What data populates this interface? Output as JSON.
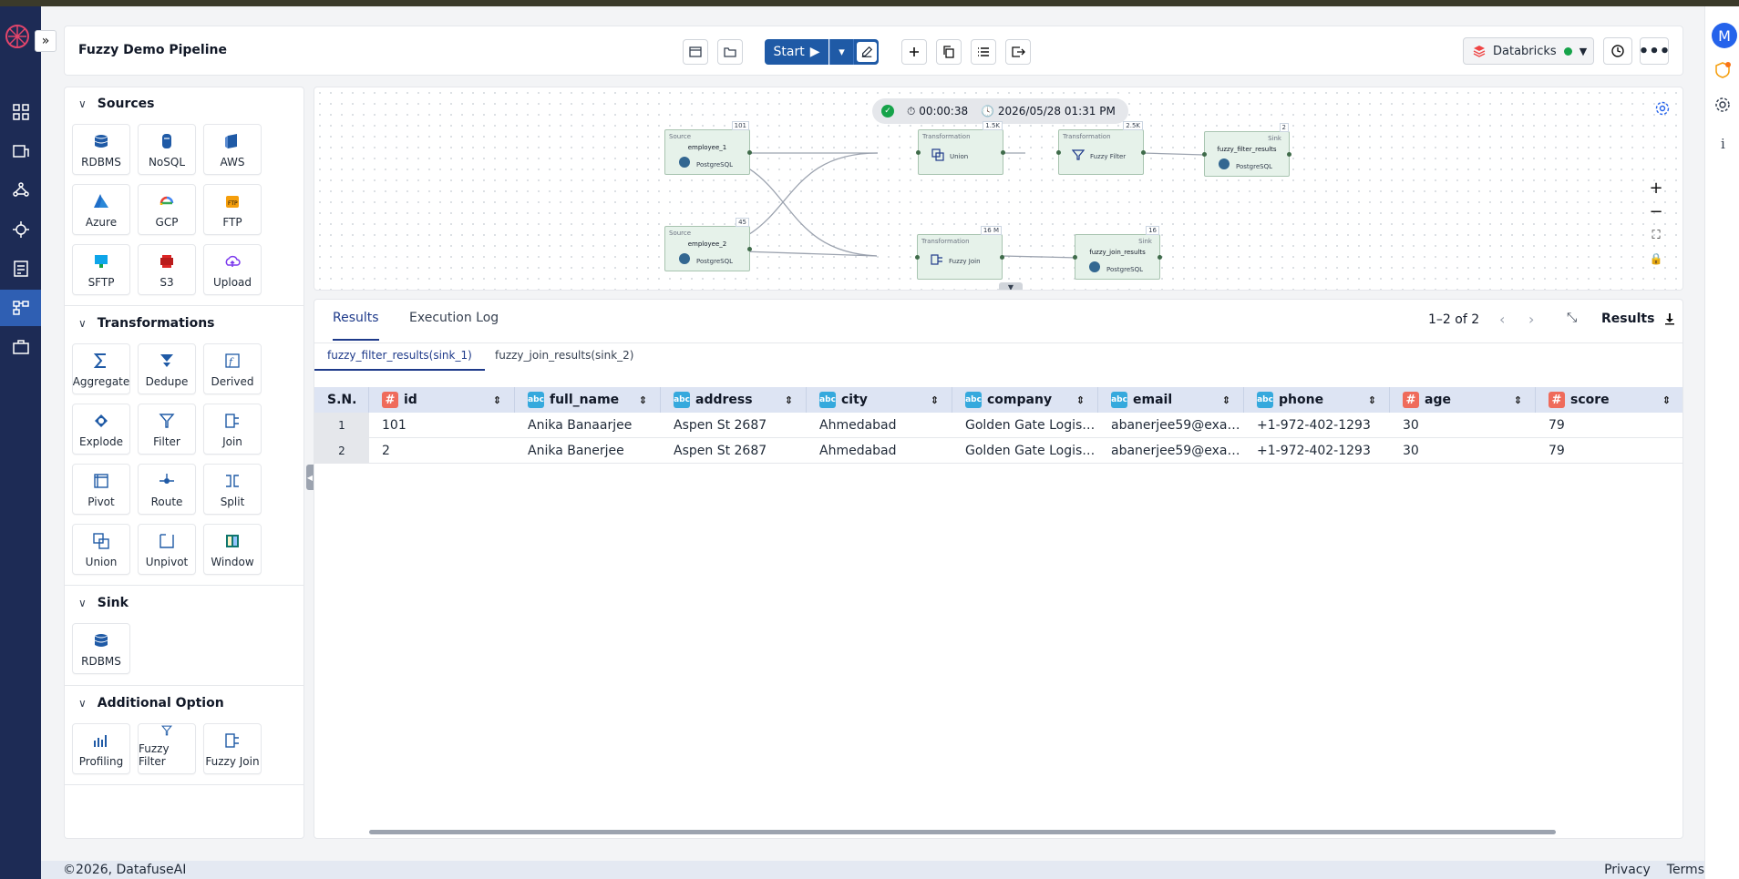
{
  "app": {
    "title": "Fuzzy Demo Pipeline",
    "avatar_letter": "M"
  },
  "toolbar": {
    "start_label": "Start",
    "environment": "Databricks",
    "env_status_color": "#16a34a",
    "accent_color": "#1f5aa6"
  },
  "sidebar": {
    "sources": {
      "title": "Sources",
      "items": [
        {
          "label": "RDBMS",
          "icon": "database-icon"
        },
        {
          "label": "NoSQL",
          "icon": "nosql-icon"
        },
        {
          "label": "AWS",
          "icon": "aws-icon"
        },
        {
          "label": "Azure",
          "icon": "azure-icon"
        },
        {
          "label": "GCP",
          "icon": "gcp-icon"
        },
        {
          "label": "FTP",
          "icon": "ftp-icon"
        },
        {
          "label": "SFTP",
          "icon": "sftp-icon"
        },
        {
          "label": "S3",
          "icon": "s3-icon"
        },
        {
          "label": "Upload",
          "icon": "upload-icon"
        }
      ]
    },
    "transformations": {
      "title": "Transformations",
      "items": [
        {
          "label": "Aggregate",
          "icon": "sigma-icon"
        },
        {
          "label": "Dedupe",
          "icon": "dedupe-icon"
        },
        {
          "label": "Derived",
          "icon": "function-icon"
        },
        {
          "label": "Explode",
          "icon": "explode-icon"
        },
        {
          "label": "Filter",
          "icon": "filter-icon"
        },
        {
          "label": "Join",
          "icon": "join-icon"
        },
        {
          "label": "Pivot",
          "icon": "pivot-icon"
        },
        {
          "label": "Route",
          "icon": "route-icon"
        },
        {
          "label": "Split",
          "icon": "split-icon"
        },
        {
          "label": "Union",
          "icon": "union-icon"
        },
        {
          "label": "Unpivot",
          "icon": "unpivot-icon"
        },
        {
          "label": "Window",
          "icon": "window-icon"
        }
      ]
    },
    "sink": {
      "title": "Sink",
      "items": [
        {
          "label": "RDBMS",
          "icon": "database-icon"
        }
      ]
    },
    "additional": {
      "title": "Additional Option",
      "items": [
        {
          "label": "Profiling",
          "icon": "profiling-icon"
        },
        {
          "label": "Fuzzy Filter",
          "icon": "filter-icon"
        },
        {
          "label": "Fuzzy Join",
          "icon": "join-icon"
        }
      ]
    }
  },
  "canvas": {
    "duration": "00:00:38",
    "timestamp": "2026/05/28 01:31 PM",
    "nodes": {
      "employee_1": {
        "type": "Source",
        "name": "employee_1",
        "db": "PostgreSQL",
        "count": "101"
      },
      "employee_2": {
        "type": "Source",
        "name": "employee_2",
        "db": "PostgreSQL",
        "count": "45"
      },
      "union": {
        "type": "Transformation",
        "name": "Union",
        "count": "1.5K"
      },
      "fuzzy_filter": {
        "type": "Transformation",
        "name": "Fuzzy Filter",
        "count": "2.5K"
      },
      "fuzzy_join": {
        "type": "Transformation",
        "name": "Fuzzy Join",
        "count": "16 M"
      },
      "sink_filter": {
        "type": "Sink",
        "name": "fuzzy_filter_results",
        "db": "PostgreSQL",
        "count": "2"
      },
      "sink_join": {
        "type": "Sink",
        "name": "fuzzy_join_results",
        "db": "PostgreSQL",
        "count": "16"
      }
    }
  },
  "results": {
    "tabs": [
      "Results",
      "Execution Log"
    ],
    "pagination": "1–2 of 2",
    "results_label": "Results",
    "subtabs": [
      "fuzzy_filter_results(sink_1)",
      "fuzzy_join_results(sink_2)"
    ],
    "columns": [
      {
        "label": "S.N.",
        "type": "none"
      },
      {
        "label": "id",
        "type": "num"
      },
      {
        "label": "full_name",
        "type": "str"
      },
      {
        "label": "address",
        "type": "str"
      },
      {
        "label": "city",
        "type": "str"
      },
      {
        "label": "company",
        "type": "str"
      },
      {
        "label": "email",
        "type": "str"
      },
      {
        "label": "phone",
        "type": "str"
      },
      {
        "label": "age",
        "type": "num"
      },
      {
        "label": "score",
        "type": "num"
      }
    ],
    "type_badges": {
      "num": "#",
      "str": "abc"
    },
    "rows": [
      [
        "1",
        "101",
        "Anika Banaarjee",
        "Aspen St 2687",
        "Ahmedabad",
        "Golden Gate Logis…",
        "abanerjee59@exa…",
        "+1-972-402-1293",
        "30",
        "79"
      ],
      [
        "2",
        "2",
        "Anika Banerjee",
        "Aspen St 2687",
        "Ahmedabad",
        "Golden Gate Logis…",
        "abanerjee59@exa…",
        "+1-972-402-1293",
        "30",
        "79"
      ]
    ]
  },
  "footer": {
    "copyright": "©2026, DatafuseAI",
    "privacy": "Privacy",
    "terms": "Terms"
  }
}
